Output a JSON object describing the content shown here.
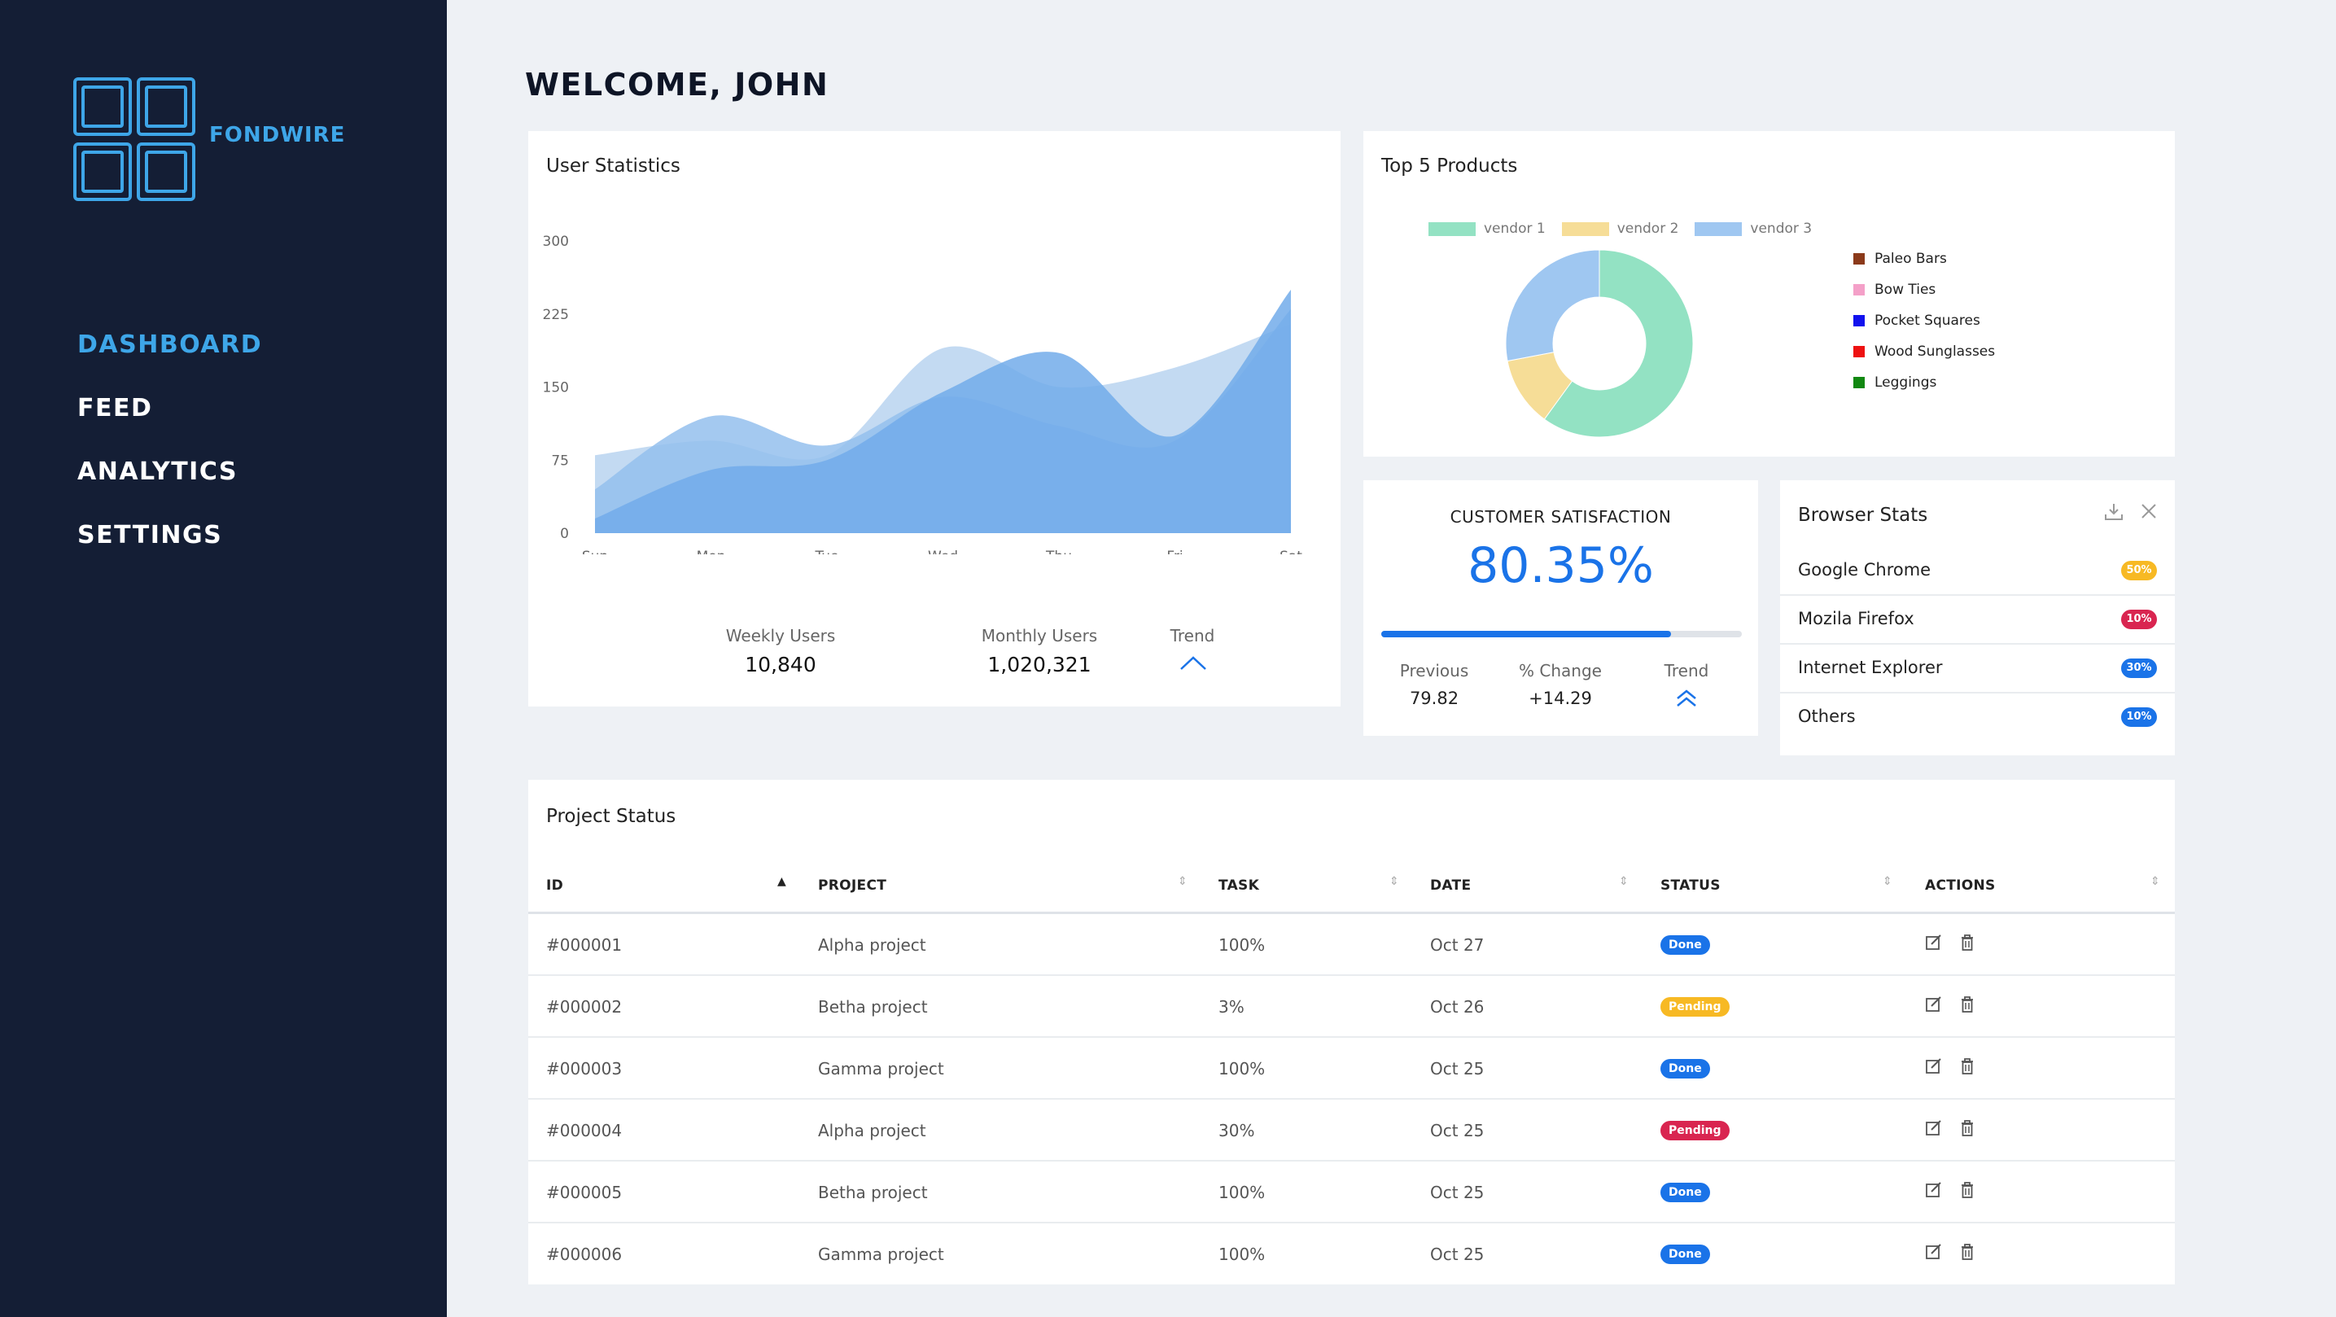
{
  "sidebar": {
    "brand": "FONDWIRE",
    "nav": [
      {
        "label": "DASHBOARD",
        "active": true
      },
      {
        "label": "FEED",
        "active": false
      },
      {
        "label": "ANALYTICS",
        "active": false
      },
      {
        "label": "SETTINGS",
        "active": false
      }
    ]
  },
  "header": {
    "welcome": "WELCOME, JOHN"
  },
  "user_stats": {
    "title": "User Statistics",
    "weekly_label": "Weekly Users",
    "weekly_value": "10,840",
    "monthly_label": "Monthly Users",
    "monthly_value": "1,020,321",
    "trend_label": "Trend"
  },
  "chart_data": [
    {
      "type": "area",
      "title": "User Statistics",
      "categories": [
        "Sun",
        "Mon",
        "Tue",
        "Wed",
        "Thu",
        "Fri",
        "Sat"
      ],
      "ylim": [
        0,
        300
      ],
      "yticks": [
        0,
        75,
        150,
        225,
        300
      ],
      "grid": false,
      "series": [
        {
          "values": [
            80,
            95,
            80,
            190,
            150,
            170,
            215
          ]
        },
        {
          "values": [
            45,
            120,
            90,
            140,
            110,
            95,
            230
          ]
        },
        {
          "values": [
            15,
            65,
            75,
            145,
            185,
            100,
            250
          ]
        }
      ],
      "colors": [
        "#b8d3f0",
        "#94c0ed",
        "#72acea"
      ]
    },
    {
      "type": "pie",
      "title": "Top 5 Products",
      "legend": [
        "vendor 1",
        "vendor 2",
        "vendor 3"
      ],
      "slices": [
        {
          "name": "vendor 1",
          "value": 60
        },
        {
          "name": "vendor 2",
          "value": 12
        },
        {
          "name": "vendor 3",
          "value": 28
        }
      ],
      "colors": [
        "#93e2c3",
        "#f6dd97",
        "#9fc7f1"
      ],
      "secondary_legend": [
        {
          "name": "Paleo Bars",
          "color": "#8b3a1a"
        },
        {
          "name": "Bow Ties",
          "color": "#f4a0c8"
        },
        {
          "name": "Pocket Squares",
          "color": "#1111ee"
        },
        {
          "name": "Wood Sunglasses",
          "color": "#ee1111"
        },
        {
          "name": "Leggings",
          "color": "#118811"
        }
      ]
    }
  ],
  "satisfaction": {
    "title": "CUSTOMER SATISFACTION",
    "value": "80.35%",
    "progress": 0.8035,
    "previous_label": "Previous",
    "previous_value": "79.82",
    "change_label": "% Change",
    "change_value": "+14.29",
    "trend_label": "Trend"
  },
  "browser_stats": {
    "title": "Browser Stats",
    "rows": [
      {
        "name": "Google Chrome",
        "pct": "50%",
        "color": "#f7b924"
      },
      {
        "name": "Mozila Firefox",
        "pct": "10%",
        "color": "#d92550"
      },
      {
        "name": "Internet Explorer",
        "pct": "30%",
        "color": "#1a73e8"
      },
      {
        "name": "Others",
        "pct": "10%",
        "color": "#1a73e8"
      }
    ]
  },
  "projects": {
    "title": "Project Status",
    "columns": [
      "ID",
      "PROJECT",
      "TASK",
      "DATE",
      "STATUS",
      "ACTIONS"
    ],
    "rows": [
      {
        "id": "#000001",
        "project": "Alpha project",
        "task": "100%",
        "date": "Oct 27",
        "status": "Done",
        "status_color": "#1a73e8"
      },
      {
        "id": "#000002",
        "project": "Betha project",
        "task": "3%",
        "date": "Oct 26",
        "status": "Pending",
        "status_color": "#f7b924"
      },
      {
        "id": "#000003",
        "project": "Gamma project",
        "task": "100%",
        "date": "Oct 25",
        "status": "Done",
        "status_color": "#1a73e8"
      },
      {
        "id": "#000004",
        "project": "Alpha project",
        "task": "30%",
        "date": "Oct 25",
        "status": "Pending",
        "status_color": "#d92550"
      },
      {
        "id": "#000005",
        "project": "Betha project",
        "task": "100%",
        "date": "Oct 25",
        "status": "Done",
        "status_color": "#1a73e8"
      },
      {
        "id": "#000006",
        "project": "Gamma project",
        "task": "100%",
        "date": "Oct 25",
        "status": "Done",
        "status_color": "#1a73e8"
      }
    ]
  },
  "colors": {
    "sidebar": "#141e35",
    "accent": "#3ea6e8",
    "primary": "#1a73e8",
    "background": "#eef1f5"
  }
}
